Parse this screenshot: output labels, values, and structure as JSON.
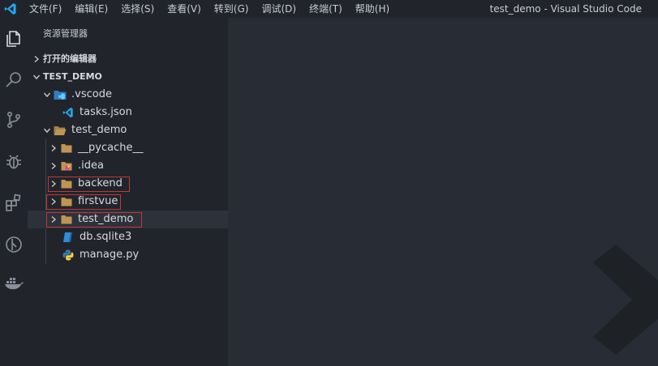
{
  "menu": [
    "文件(F)",
    "编辑(E)",
    "选择(S)",
    "查看(V)",
    "转到(G)",
    "调试(D)",
    "终端(T)",
    "帮助(H)"
  ],
  "window_title": "test_demo - Visual Studio Code",
  "sidebar": {
    "title": "资源管理器",
    "sections": {
      "open_editors": "打开的编辑器",
      "project": "TEST_DEMO"
    }
  },
  "tree": {
    "vscode": ".vscode",
    "tasks": "tasks.json",
    "test_demo": "test_demo",
    "pycache": "__pycache__",
    "idea": ".idea",
    "backend": "backend",
    "firstvue": "firstvue",
    "test_demo_inner": "test_demo",
    "db": "db.sqlite3",
    "manage": "manage.py"
  },
  "colors": {
    "accent_vscode_blue": "#23a9f2",
    "folder": "#c09553",
    "highlight_border": "#c3363a"
  }
}
